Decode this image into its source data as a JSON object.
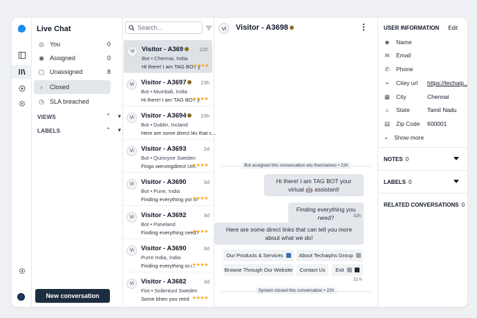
{
  "sidebar": {
    "title": "Live Chat",
    "items": [
      {
        "label": "You",
        "count": "0",
        "icon": "circle-icon"
      },
      {
        "label": "Assigned",
        "count": "0",
        "icon": "user-icon"
      },
      {
        "label": "Unassigned",
        "count": "8",
        "icon": "inbox-icon"
      },
      {
        "label": "Closed",
        "count": "",
        "icon": "chevron-right-icon"
      },
      {
        "label": "SLA breached",
        "count": "",
        "icon": "clock-icon"
      }
    ],
    "views_label": "VIEWS",
    "labels_label": "LABELS",
    "new_conversation": "New conversation"
  },
  "search": {
    "placeholder": "Search..."
  },
  "conversations": [
    {
      "avatar": "Vi",
      "name": "Visitor - A369",
      "time": "22h",
      "sub": "Bot • Chennai, India",
      "msg": "Hi there! I am TAG BOT y",
      "stars": "★★★★",
      "bot": true
    },
    {
      "avatar": "Vi",
      "name": "Visitor - A3697",
      "time": "23h",
      "sub": "Bot • Mumbali, India",
      "msg": "Hi there! I am TAG BOT y",
      "stars": "★★★★",
      "bot": true
    },
    {
      "avatar": "Vi",
      "name": "Visitor - A3694",
      "time": "23h",
      "sub": "Bot • Dublin, Incland",
      "msg": "Here are some direct l4s that c...",
      "stars": "",
      "bot": true
    },
    {
      "avatar": "Vi",
      "name": "Visitor - A3693",
      "time": "2d",
      "sub": "Bot • Quincyne Sweden",
      "msg": "Fingo wervingdirect Um.",
      "stars": "★★★★",
      "bot": false
    },
    {
      "avatar": "Vi",
      "name": "Visitor - A3690",
      "time": "3d",
      "sub": "Bot • Pune, India",
      "msg": "Finding everything yor in",
      "stars": "★★★★",
      "bot": false
    },
    {
      "avatar": "Vi",
      "name": "Visitor - A3692",
      "time": "3d",
      "sub": "Bot • Paneland",
      "msg": "Finding everything ceed?",
      "stars": "★★★★",
      "bot": false
    },
    {
      "avatar": "Vi",
      "name": "Visitor - A3690",
      "time": "3d",
      "sub": "Purre India, India",
      "msg": "Finding everything or.i...",
      "stars": "★★★★",
      "bot": false
    },
    {
      "avatar": "Vi",
      "name": "Visitor - A3682",
      "time": "3d",
      "sub": "Fint • Sollentunl Sweden",
      "msg": "Some bhen you reed",
      "stars": "★★★★",
      "bot": false
    }
  ],
  "chat": {
    "avatar": "Vi",
    "title": "Visitor - A3698",
    "system_assigned": "Bot assigned this conversation eto themselves  •  22h",
    "msg1": "Hi there! I am TAG BOT your virtual 🤖 assistant!",
    "msg2": "Finding everything you need?",
    "msg2_time": "32h",
    "msg3": "Here are some direct links that can tell you more about what we do!",
    "quick": [
      {
        "label": "Our Products & Services"
      },
      {
        "label": "About Techaiphs Group"
      },
      {
        "label": "Browse Through Our Website"
      },
      {
        "label": "Contact Us"
      },
      {
        "label": "Exit"
      }
    ],
    "msg3_time": "22 h",
    "system_closed": "System closed this conversation  •  22h"
  },
  "user_info": {
    "heading": "USER INFORMATION",
    "edit": "Edit",
    "fields": [
      {
        "icon": "user-icon",
        "label": "Name",
        "value": ""
      },
      {
        "icon": "mail-icon",
        "label": "Email",
        "value": ""
      },
      {
        "icon": "phone-icon",
        "label": "Phone",
        "value": ""
      },
      {
        "icon": "pin-icon",
        "label": "Citey url",
        "value": "https://techaip...",
        "link": true
      },
      {
        "icon": "building-icon",
        "label": "City",
        "value": "Chennai"
      },
      {
        "icon": "home-icon",
        "label": "State",
        "value": "Tamil Nadu"
      },
      {
        "icon": "doc-icon",
        "label": "Zip Code",
        "value": "600001"
      }
    ],
    "show_more": "Show more",
    "notes": "NOTES",
    "notes_count": "0",
    "labels": "LABELS",
    "labels_count": "0",
    "related": "RELATED CONVERSATIONS",
    "related_count": "0"
  }
}
